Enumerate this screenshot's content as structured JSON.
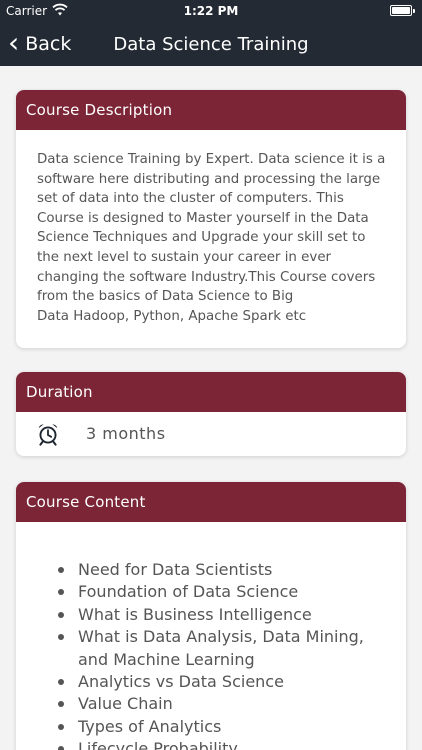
{
  "status": {
    "carrier": "Carrier",
    "time": "1:22 PM"
  },
  "nav": {
    "back_label": "Back",
    "title": "Data Science Training"
  },
  "description": {
    "header": "Course Description",
    "paragraph": "Data science Training by Expert. Data science it is a software here distributing and processing the large set of data into the cluster of computers. This Course is designed to Master yourself in the Data Science Techniques and Upgrade your skill set to the next level to sustain your career in ever changing the software Industry.This Course covers from the basics of Data Science to Big",
    "paragraph_line2": "Data Hadoop, Python, Apache Spark etc"
  },
  "duration": {
    "header": "Duration",
    "value": "3 months"
  },
  "course_content": {
    "header": "Course Content",
    "items": [
      "Need for Data Scientists",
      "Foundation of Data Science",
      "What is Business Intelligence",
      "What is Data Analysis, Data Mining, and Machine Learning",
      "Analytics vs Data Science",
      "Value Chain",
      "Types of Analytics",
      "Lifecycle Probability"
    ]
  },
  "colors": {
    "accent": "#7b2536",
    "navbar": "#232a33",
    "background": "#f3f3f3"
  },
  "icons": {
    "back": "chevron-left-icon",
    "duration": "alarm-clock-icon",
    "wifi": "wifi-icon",
    "battery": "battery-icon"
  }
}
